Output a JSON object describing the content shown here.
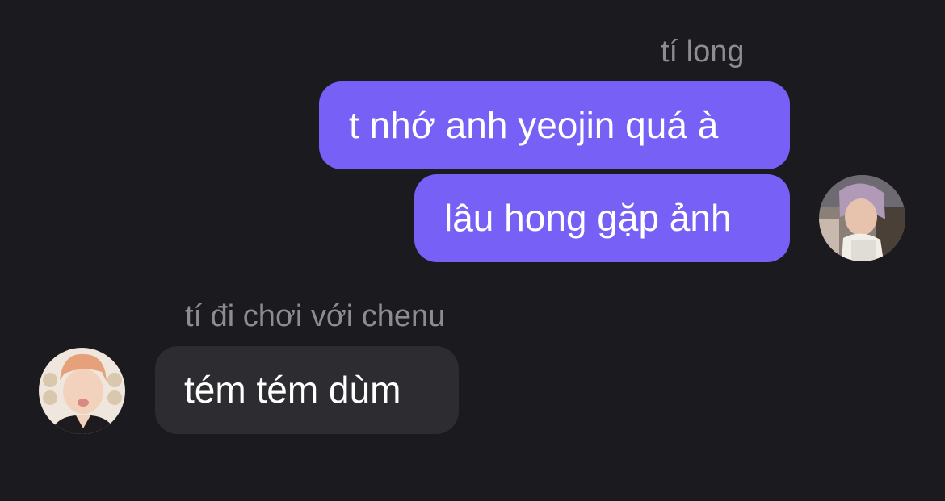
{
  "chat": {
    "outgoing": {
      "sender_name": "tí long",
      "messages": [
        "t nhớ anh yeojin quá à",
        "lâu hong gặp ảnh"
      ]
    },
    "incoming": {
      "sender_name": "tí đi chơi với chenu",
      "messages": [
        "tém tém dùm"
      ]
    }
  },
  "colors": {
    "background": "#1b1a1f",
    "outgoing_bubble": "#7760f5",
    "incoming_bubble": "#2d2c31",
    "sender_name": "#8d8c93",
    "message_text": "#ffffff"
  }
}
